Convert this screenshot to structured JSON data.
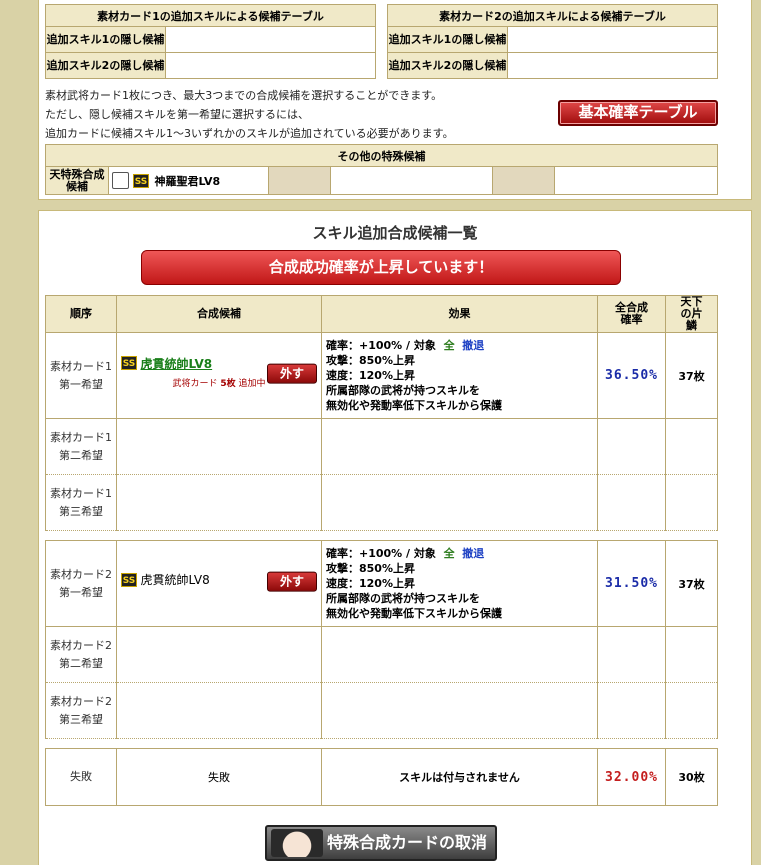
{
  "card1_table": {
    "title": "素材カード1の追加スキルによる候補テーブル",
    "row1_label": "追加スキル1の隠し候補",
    "row2_label": "追加スキル2の隠し候補"
  },
  "card2_table": {
    "title": "素材カード2の追加スキルによる候補テーブル",
    "row1_label": "追加スキル1の隠し候補",
    "row2_label": "追加スキル2の隠し候補"
  },
  "notes": [
    "素材武将カード1枚につき、最大3つまでの合成候補を選択することができます。",
    "ただし、隠し候補スキルを第一希望に選択するには、",
    "追加カードに候補スキル1～3いずれかのスキルが追加されている必要があります。"
  ],
  "basic_rate_button": "基本確率テーブル",
  "special": {
    "title": "その他の特殊候補",
    "label": "天特殊合成候補",
    "rank": "SS",
    "skill": "神羅聖君LV8"
  },
  "list": {
    "title": "スキル追加合成候補一覧",
    "banner": "合成成功確率が上昇しています！",
    "headers": {
      "order": "順序",
      "candidate": "合成候補",
      "effect": "効果",
      "rate": "全合成確率",
      "shards": "天下の片鱗"
    }
  },
  "group1": {
    "rows": [
      {
        "order_a": "素材カード1",
        "order_b": "第一希望"
      },
      {
        "order_a": "素材カード1",
        "order_b": "第二希望"
      },
      {
        "order_a": "素材カード1",
        "order_b": "第三希望"
      }
    ],
    "candidate": {
      "rank": "SS",
      "name": "虎貫統帥LV8",
      "remove_label": "外す",
      "note_prefix": "武将カード",
      "note_count": "5枚",
      "note_suffix": "追加中"
    },
    "effect": {
      "line1_a": "確率：+100% / 対象",
      "target1": "全",
      "target2": "撤退",
      "line2": "攻撃：850%上昇",
      "line3": "速度：120%上昇",
      "line4": "所属部隊の武将が持つスキルを",
      "line5": "無効化や発動率低下スキルから保護"
    },
    "rate": "36.50%",
    "shards": "37枚"
  },
  "group2": {
    "rows": [
      {
        "order_a": "素材カード2",
        "order_b": "第一希望"
      },
      {
        "order_a": "素材カード2",
        "order_b": "第二希望"
      },
      {
        "order_a": "素材カード2",
        "order_b": "第三希望"
      }
    ],
    "candidate": {
      "rank": "SS",
      "name": "虎貫統帥LV8",
      "remove_label": "外す"
    },
    "effect": {
      "line1_a": "確率：+100% / 対象",
      "target1": "全",
      "target2": "撤退",
      "line2": "攻撃：850%上昇",
      "line3": "速度：120%上昇",
      "line4": "所属部隊の武将が持つスキルを",
      "line5": "無効化や発動率低下スキルから保護"
    },
    "rate": "31.50%",
    "shards": "37枚"
  },
  "failure": {
    "order": "失敗",
    "candidate": "失敗",
    "effect": "スキルは付与されません",
    "rate": "32.00%",
    "shards": "30枚"
  },
  "cancel_button": "特殊合成カードの取消"
}
